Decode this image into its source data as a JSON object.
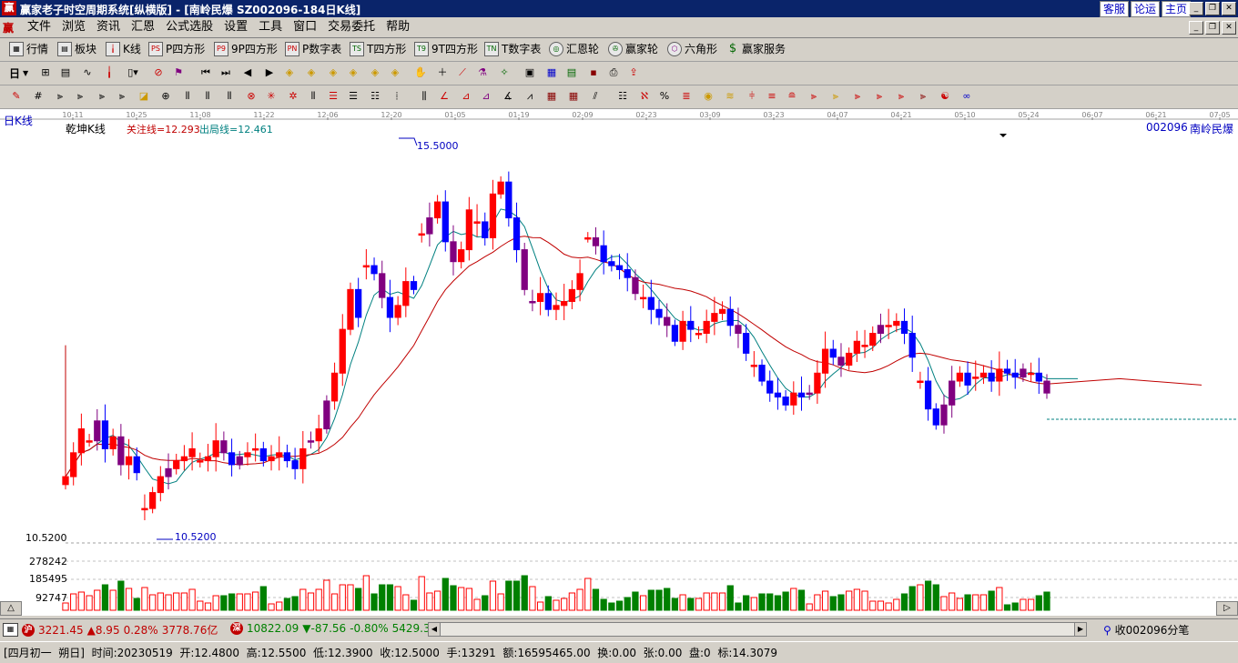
{
  "title_bar": {
    "title": "赢家老子时空周期系统[纵横版] - [南岭民爆   SZ002096-184日K线]",
    "links": [
      "客服",
      "论运",
      "主页"
    ],
    "app_icon": "赢"
  },
  "menu": {
    "logo": "赢",
    "items": [
      "文件",
      "浏览",
      "资讯",
      "汇恩",
      "公式选股",
      "设置",
      "工具",
      "窗口",
      "交易委托",
      "帮助"
    ]
  },
  "toolbar1": {
    "items": [
      {
        "icon": "grid-icon",
        "label": "行情"
      },
      {
        "icon": "blocks-icon",
        "label": "板块"
      },
      {
        "icon": "candles-icon",
        "label": "K线"
      },
      {
        "icon": "PS",
        "label": "P四方形"
      },
      {
        "icon": "P9",
        "label": "9P四方形"
      },
      {
        "icon": "PN",
        "label": "P数字表"
      },
      {
        "icon": "TS",
        "label": "T四方形"
      },
      {
        "icon": "T9",
        "label": "9T四方形"
      },
      {
        "icon": "TN",
        "label": "T数字表"
      },
      {
        "icon": "target-icon",
        "label": "汇恩轮"
      },
      {
        "icon": "wheel-icon",
        "label": "赢家轮"
      },
      {
        "icon": "hexagon-icon",
        "label": "六角形"
      },
      {
        "icon": "dollar-icon",
        "label": "赢家服务"
      }
    ]
  },
  "toolbar2": {
    "period": "日"
  },
  "chart": {
    "top_label": "日K线",
    "indicator_name": "乾坤K线",
    "focus_line": "关注线=12.293",
    "exit_line": "出局线=12.461",
    "stock_code": "002096",
    "stock_name": "南岭民爆",
    "high_label": "15.5000",
    "low_label": "10.5200",
    "axis_low": "10.5200",
    "vol_ticks": [
      "278242",
      "185495",
      "92747"
    ],
    "date_ticks": [
      "10-11",
      "10-25",
      "11-08",
      "11-22",
      "12-06",
      "12-20",
      "01-05",
      "01-19",
      "02-09",
      "02-23",
      "03-09",
      "03-23",
      "04-07",
      "04-21",
      "05-10",
      "05-24",
      "06-07",
      "06-21",
      "07-05"
    ],
    "colors": {
      "up": "#ff0000",
      "down": "#0000ff",
      "purple": "#800080",
      "ma_long": "#c00000",
      "ma_short": "#008080",
      "volume_down": "#008000"
    }
  },
  "status1": {
    "sh_badge": "沪",
    "sh_index": "3221.45",
    "sh_change": "▲8.95",
    "sh_pct": "0.28%",
    "sh_amount": "3778.76亿",
    "sz_badge": "深",
    "sz_index": "10822.09",
    "sz_change": "▼-87.56",
    "sz_pct": "-0.80%",
    "sz_amount": "5429.3",
    "right_text": "收002096分笔"
  },
  "status2": {
    "text": "[四月初一  朔日]  时间:20230519  开:12.4800  高:12.5500  低:12.3900  收:12.5000  手:13291  额:16595465.00  换:0.00  张:0.00  盘:0  标:14.3079"
  },
  "chart_data": {
    "type": "candlestick",
    "title": "",
    "ylim": [
      10.52,
      15.5
    ],
    "x_ticks": [
      "10-11",
      "10-25",
      "11-08",
      "11-22",
      "12-06",
      "12-20",
      "01-05",
      "01-19",
      "02-09",
      "02-23",
      "03-09",
      "03-23",
      "04-07",
      "04-21",
      "05-10",
      "05-24",
      "06-07",
      "06-21",
      "07-05"
    ],
    "series": [
      {
        "name": "关注线",
        "values": [
          12.293
        ]
      },
      {
        "name": "出局线",
        "values": [
          12.461
        ]
      }
    ],
    "closes": [
      11.25,
      11.55,
      11.85,
      11.7,
      11.95,
      11.6,
      11.75,
      11.4,
      11.5,
      11.3,
      10.85,
      11.05,
      11.25,
      11.35,
      11.45,
      11.5,
      11.6,
      11.45,
      11.5,
      11.7,
      11.55,
      11.4,
      11.5,
      11.55,
      11.6,
      11.45,
      11.5,
      11.55,
      11.45,
      11.35,
      11.6,
      11.7,
      11.85,
      12.2,
      12.55,
      13.1,
      13.6,
      13.25,
      13.9,
      13.8,
      13.5,
      13.25,
      13.4,
      13.7,
      13.6,
      14.3,
      14.5,
      14.7,
      14.2,
      13.95,
      14.1,
      14.6,
      14.45,
      14.25,
      14.8,
      14.95,
      14.5,
      14.1,
      13.6,
      13.45,
      13.55,
      13.35,
      13.4,
      13.45,
      13.6,
      13.8,
      14.25,
      14.15,
      13.95,
      13.9,
      13.85,
      13.75,
      13.55,
      13.5,
      13.35,
      13.25,
      13.15,
      12.95,
      13.2,
      13.1,
      13.05,
      13.2,
      13.3,
      13.35,
      13.15,
      13.05,
      12.8,
      12.65,
      12.45,
      12.3,
      12.25,
      12.15,
      12.3,
      12.25,
      12.3,
      12.55,
      12.85,
      12.75,
      12.65,
      12.8,
      12.95,
      12.9,
      13.05,
      13.15,
      13.15,
      13.2,
      13.05,
      12.75,
      12.45,
      12.1,
      11.9,
      12.15,
      12.45,
      12.55,
      12.4,
      12.5,
      12.55,
      12.45,
      12.6,
      12.55,
      12.5,
      12.6,
      12.55,
      12.45,
      12.3
    ]
  }
}
